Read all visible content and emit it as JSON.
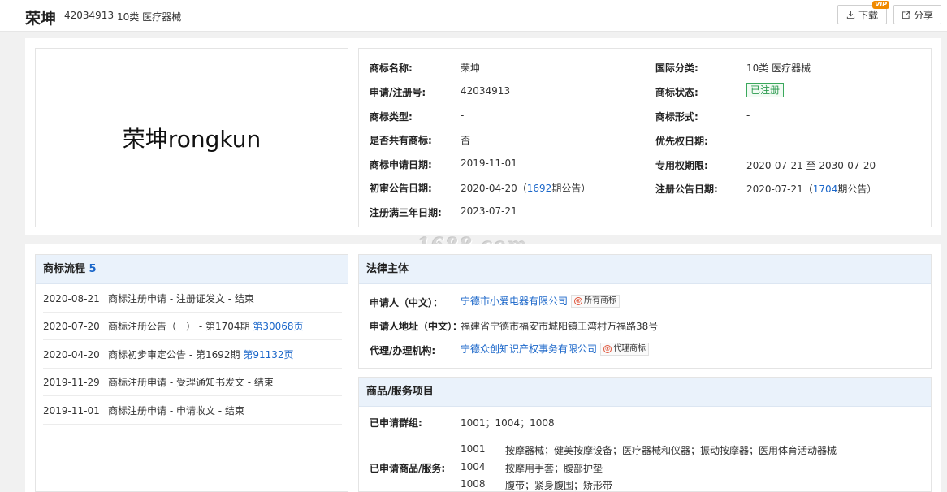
{
  "header": {
    "title": "荣坤",
    "reg_no": "42034913",
    "class": "10类 医疗器械",
    "download_label": "下载",
    "vip_badge": "VIP",
    "share_label": "分享"
  },
  "logo": {
    "text": "荣坤rongkun"
  },
  "info": {
    "name_label": "商标名称:",
    "name_value": "荣坤",
    "intl_class_label": "国际分类:",
    "intl_class_value": "10类 医疗器械",
    "reg_no_label": "申请/注册号:",
    "reg_no_value": "42034913",
    "status_label": "商标状态:",
    "status_value": "已注册",
    "type_label": "商标类型:",
    "type_value": "-",
    "form_label": "商标形式:",
    "form_value": "-",
    "shared_label": "是否共有商标:",
    "shared_value": "否",
    "priority_label": "优先权日期:",
    "priority_value": "-",
    "apply_date_label": "商标申请日期:",
    "apply_date_value": "2019-11-01",
    "exclusive_label": "专用权期限:",
    "exclusive_value": "2020-07-21 至 2030-07-20",
    "prelim_label": "初审公告日期:",
    "prelim_date": "2020-04-20",
    "prelim_open": "（",
    "prelim_issue": "1692",
    "prelim_suffix": "期公告）",
    "reg_pub_label": "注册公告日期:",
    "reg_pub_date": "2020-07-21",
    "reg_pub_open": "（",
    "reg_pub_issue": "1704",
    "reg_pub_suffix": "期公告）",
    "three_year_label": "注册满三年日期:",
    "three_year_value": "2023-07-21"
  },
  "watermark": "1688.com",
  "flow": {
    "title": "商标流程",
    "count": "5",
    "items": [
      {
        "date": "2020-08-21",
        "desc": "商标注册申请 - 注册证发文 - 结束",
        "link": ""
      },
      {
        "date": "2020-07-20",
        "desc": "商标注册公告（一） - 第1704期 ",
        "link": "第30068页"
      },
      {
        "date": "2020-04-20",
        "desc": "商标初步审定公告 - 第1692期 ",
        "link": "第91132页"
      },
      {
        "date": "2019-11-29",
        "desc": "商标注册申请 - 受理通知书发文 - 结束",
        "link": ""
      },
      {
        "date": "2019-11-01",
        "desc": "商标注册申请 - 申请收文 - 结束",
        "link": ""
      }
    ]
  },
  "legal": {
    "title": "法律主体",
    "applicant_label": "申请人（中文）：",
    "applicant_value": "宁德市小爱电器有限公司",
    "applicant_tag": "所有商标",
    "address_label": "申请人地址（中文）：",
    "address_value": "福建省宁德市福安市城阳镇王湾村万福路38号",
    "agent_label": "代理/办理机构:",
    "agent_value": "宁德众创知识产权事务有限公司",
    "agent_tag": "代理商标"
  },
  "goods": {
    "title": "商品/服务项目",
    "groups_label": "已申请群组:",
    "groups_value": "1001；1004；1008",
    "items_label": "已申请商品/服务:",
    "items": [
      {
        "code": "1001",
        "desc": "按摩器械；健美按摩设备；医疗器械和仪器；振动按摩器；医用体育活动器械"
      },
      {
        "code": "1004",
        "desc": "按摩用手套；腹部护垫"
      },
      {
        "code": "1008",
        "desc": "腹带；紧身腹围；矫形带"
      }
    ]
  },
  "colors": {
    "link": "#1a66c9",
    "status_green": "#2b9a4e",
    "head_bg": "#eaf2fb",
    "vip": "#f08a00"
  }
}
